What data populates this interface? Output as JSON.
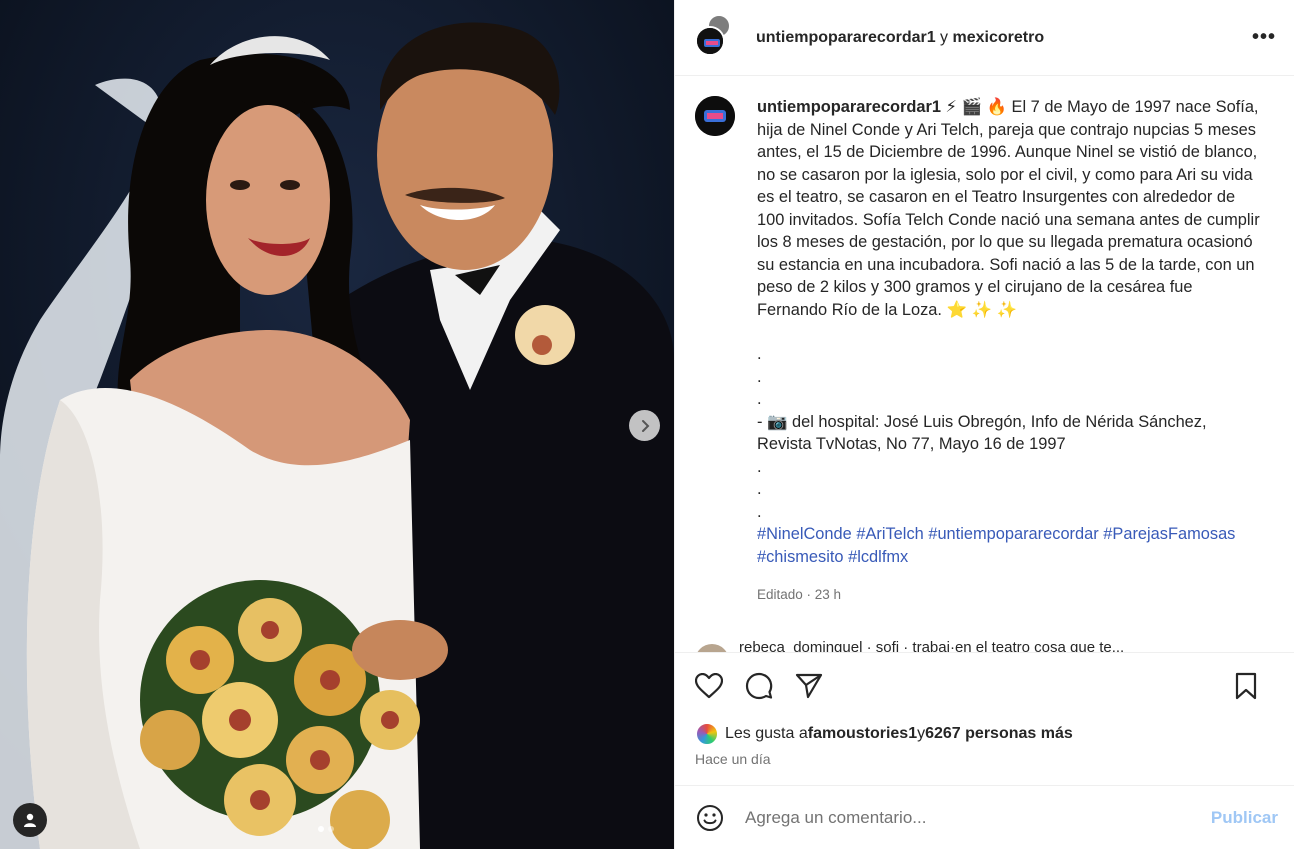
{
  "post": {
    "media_alt": "wedding-photo",
    "carousel": {
      "count": 2,
      "active_index": 0
    }
  },
  "header": {
    "user1": "untiempopararecordar1",
    "connector": " y ",
    "user2": "mexicoretro",
    "more_label": "•••"
  },
  "caption": {
    "username": "untiempopararecordar1",
    "emojis": " ⚡ 🎬 🔥 ",
    "paragraph1": "El 7 de Mayo de 1997 nace Sofía, hija de Ninel Conde y Ari Telch, pareja que contrajo nupcias 5 meses antes, el 15 de Diciembre de 1996. Aunque Ninel se vistió de blanco, no se casaron por la iglesia, solo por el civil, y como para Ari su vida es el teatro, se casaron en el Teatro Insurgentes con alrededor de 100 invitados. Sofía Telch Conde nació una semana antes de cumplir los 8 meses de gestación, por lo que su llegada prematura ocasionó su estancia en una incubadora. Sofi nació a las 5 de la tarde, con un peso de 2 kilos y 300 gramos y el cirujano de la cesárea fue Fernando Río de la Loza.",
    "paragraph1_end_emojis": " ⭐ ✨ ✨",
    "dot1": ".",
    "dot2": ".",
    "dot3": ".",
    "credit": "- 📷 del hospital: José Luis Obregón, Info de Nérida Sánchez, Revista TvNotas, No 77, Mayo 16 de 1997",
    "dot4": ".",
    "dot5": ".",
    "dot6": ".",
    "hashtags": [
      "#NinelConde",
      "#AriTelch",
      "#untiempopararecordar",
      "#ParejasFamosas",
      "#chismesito",
      "#lcdlfmx"
    ],
    "edited_meta": "Editado · 23 h"
  },
  "next_comment": {
    "text": "rebeca_dominguel · sofi · trabaj·en el teatro cosa que te..."
  },
  "actions": {
    "like_icon": "heart-icon",
    "comment_icon": "comment-icon",
    "share_icon": "share-icon",
    "save_icon": "bookmark-icon"
  },
  "likes": {
    "prefix": "Les gusta a ",
    "user": "famoustories1",
    "connector": " y ",
    "others": "6267 personas más"
  },
  "time": "Hace un día",
  "comment_box": {
    "placeholder": "Agrega un comentario...",
    "publish_label": "Publicar",
    "publish_color": "#9fc7f5"
  }
}
